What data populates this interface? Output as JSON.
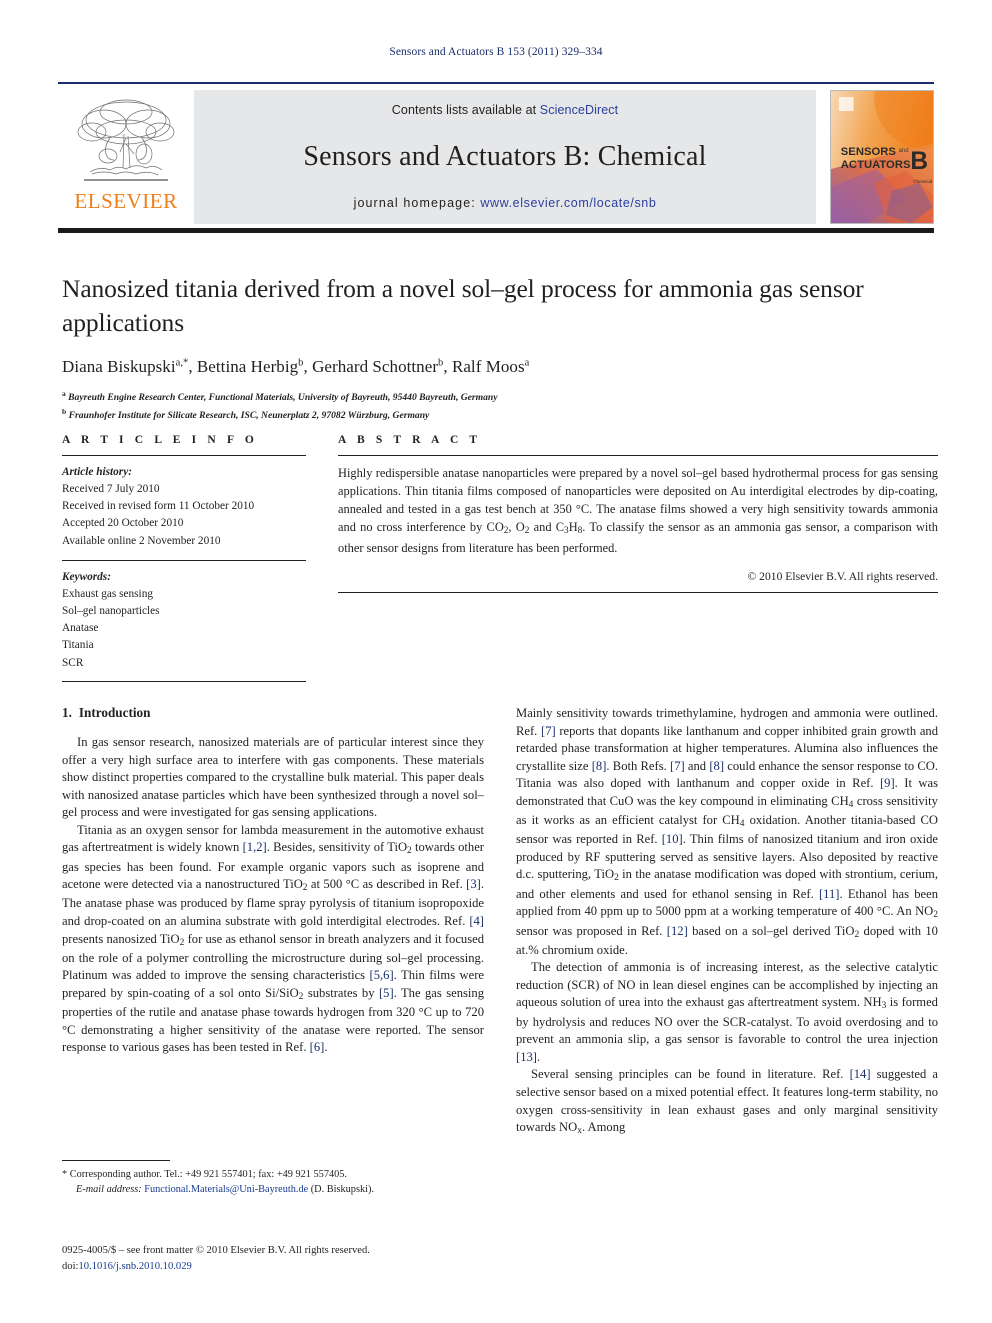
{
  "running_head": "Sensors and Actuators B 153 (2011) 329–334",
  "masthead": {
    "contents_prefix": "Contents lists available at ",
    "sciencedirect": "ScienceDirect",
    "journal_title": "Sensors and Actuators B: Chemical",
    "homepage_label": "journal homepage:",
    "homepage_url": "www.elsevier.com/locate/snb",
    "publisher": "ELSEVIER",
    "cover": {
      "line1": "SENSORS",
      "line1_small": "and",
      "line2": "ACTUATORS",
      "letter": "B",
      "letter_sub": "Chemical",
      "bg_color": "#f08b21",
      "accent_color": "#8a5ca8"
    },
    "rule_color_top": "#1a2f6b",
    "rule_color_bottom": "#1a1a1a"
  },
  "article": {
    "title": "Nanosized titania derived from a novel sol–gel process for ammonia gas sensor applications",
    "authors_html": "Diana Biskupski<sup>a,</sup><sup>*</sup>, Bettina Herbig<sup>b</sup>, Gerhard Schottner<sup>b</sup>, Ralf Moos<sup>a</sup>",
    "affiliation_a": "Bayreuth Engine Research Center, Functional Materials, University of Bayreuth, 95440 Bayreuth, Germany",
    "affiliation_b": "Fraunhofer Institute for Silicate Research, ISC, Neunerplatz 2, 97082 Würzburg, Germany"
  },
  "article_info": {
    "heading": "A R T I C L E   I N F O",
    "history_label": "Article history:",
    "history": [
      "Received 7 July 2010",
      "Received in revised form 11 October 2010",
      "Accepted 20 October 2010",
      "Available online 2 November 2010"
    ],
    "keywords_label": "Keywords:",
    "keywords": [
      "Exhaust gas sensing",
      "Sol–gel nanoparticles",
      "Anatase",
      "Titania",
      "SCR"
    ]
  },
  "abstract": {
    "heading": "A B S T R A C T",
    "text_html": "Highly redispersible anatase nanoparticles were prepared by a novel sol–gel based hydrothermal process for gas sensing applications. Thin titania films composed of nanoparticles were deposited on Au interdigital electrodes by dip-coating, annealed and tested in a gas test bench at 350 °C. The anatase films showed a very high sensitivity towards ammonia and no cross interference by CO<span class=\"sub\">2</span>, O<span class=\"sub\">2</span> and C<span class=\"sub\">3</span>H<span class=\"sub\">8</span>. To classify the sensor as an ammonia gas sensor, a comparison with other sensor designs from literature has been performed.",
    "copyright": "© 2010 Elsevier B.V. All rights reserved."
  },
  "introduction": {
    "number": "1.",
    "title": "Introduction",
    "paragraphs_left_html": [
      "In gas sensor research, nanosized materials are of particular interest since they offer a very high surface area to interfere with gas components. These materials show distinct properties compared to the crystalline bulk material. This paper deals with nanosized anatase particles which have been synthesized through a novel sol–gel process and were investigated for gas sensing applications.",
      "Titania as an oxygen sensor for lambda measurement in the automotive exhaust gas aftertreatment is widely known <span class=\"ref\">[1,2]</span>. Besides, sensitivity of TiO<span class=\"sub\">2</span> towards other gas species has been found. For example organic vapors such as isoprene and acetone were detected via a nanostructured TiO<span class=\"sub\">2</span> at 500 °C as described in Ref. <span class=\"ref\">[3]</span>. The anatase phase was produced by flame spray pyrolysis of titanium isopropoxide and drop-coated on an alumina substrate with gold interdigital electrodes. Ref. <span class=\"ref\">[4]</span> presents nanosized TiO<span class=\"sub\">2</span> for use as ethanol sensor in breath analyzers and it focused on the role of a polymer controlling the microstructure during sol–gel processing. Platinum was added to improve the sensing characteristics <span class=\"ref\">[5,6]</span>. Thin films were prepared by spin-coating of a sol onto Si/SiO<span class=\"sub\">2</span> substrates by <span class=\"ref\">[5]</span>. The gas sensing properties of the rutile and anatase phase towards hydrogen from 320 °C up to 720 °C demonstrating a higher sensitivity of the anatase were reported. The sensor response to various gases has been tested in Ref. <span class=\"ref\">[6]</span>."
    ],
    "paragraphs_right_html": [
      "Mainly sensitivity towards trimethylamine, hydrogen and ammonia were outlined. Ref. <span class=\"ref\">[7]</span> reports that dopants like lanthanum and copper inhibited grain growth and retarded phase transformation at higher temperatures. Alumina also influences the crystallite size <span class=\"ref\">[8]</span>. Both Refs. <span class=\"ref\">[7]</span> and <span class=\"ref\">[8]</span> could enhance the sensor response to CO. Titania was also doped with lanthanum and copper oxide in Ref. <span class=\"ref\">[9]</span>. It was demonstrated that CuO was the key compound in eliminating CH<span class=\"sub\">4</span> cross sensitivity as it works as an efficient catalyst for CH<span class=\"sub\">4</span> oxidation. Another titania-based CO sensor was reported in Ref. <span class=\"ref\">[10]</span>. Thin films of nanosized titanium and iron oxide produced by RF sputtering served as sensitive layers. Also deposited by reactive d.c. sputtering, TiO<span class=\"sub\">2</span> in the anatase modification was doped with strontium, cerium, and other elements and used for ethanol sensing in Ref. <span class=\"ref\">[11]</span>. Ethanol has been applied from 40 ppm up to 5000 ppm at a working temperature of 400 °C. An NO<span class=\"sub\">2</span> sensor was proposed in Ref. <span class=\"ref\">[12]</span> based on a sol–gel derived TiO<span class=\"sub\">2</span> doped with 10 at.% chromium oxide.",
      "The detection of ammonia is of increasing interest, as the selective catalytic reduction (SCR) of NO in lean diesel engines can be accomplished by injecting an aqueous solution of urea into the exhaust gas aftertreatment system. NH<span class=\"sub\">3</span> is formed by hydrolysis and reduces NO over the SCR-catalyst. To avoid overdosing and to prevent an ammonia slip, a gas sensor is favorable to control the urea injection <span class=\"ref\">[13]</span>.",
      "Several sensing principles can be found in literature. Ref. <span class=\"ref\">[14]</span> suggested a selective sensor based on a mixed potential effect. It features long-term stability, no oxygen cross-sensitivity in lean exhaust gases and only marginal sensitivity towards NO<span class=\"sub\">x</span>. Among"
    ]
  },
  "footnote": {
    "marker": "*",
    "corresponding_html": "Corresponding author. Tel.: +49 921 557401; fax: +49 921 557405.",
    "email_label": "E-mail address:",
    "email": "Functional.Materials@Uni-Bayreuth.de",
    "email_owner": "(D. Biskupski)."
  },
  "footer": {
    "issn_line": "0925-4005/$ – see front matter © 2010 Elsevier B.V. All rights reserved.",
    "doi_label": "doi:",
    "doi": "10.1016/j.snb.2010.10.029"
  }
}
